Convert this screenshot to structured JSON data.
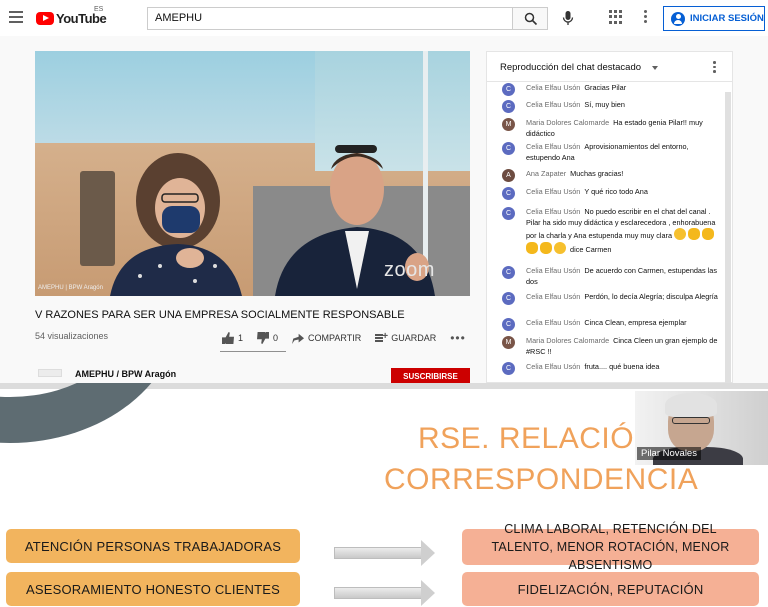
{
  "masthead": {
    "logo_text": "YouTube",
    "country_code": "ES",
    "search_value": "AMEPHU",
    "signin_label": "INICIAR SESIÓN"
  },
  "video": {
    "overlay_brand": "zoom",
    "credit": "AMEPHU | BPW Aragón",
    "title": "V RAZONES PARA SER UNA EMPRESA SOCIALMENTE RESPONSABLE",
    "views": "54 visualizaciones",
    "likes": "1",
    "dislikes": "0",
    "share_label": "COMPARTIR",
    "save_label": "GUARDAR",
    "more_label": "•••",
    "channel_name": "AMEPHU / BPW Aragón",
    "subscribe_label": "SUSCRIBIRSE"
  },
  "chat": {
    "title": "Reproducción del chat destacado",
    "messages": [
      {
        "initial": "C",
        "color": "#5c6bc0",
        "author": "Celia Elfau Usón",
        "text": "Gracias Pilar"
      },
      {
        "initial": "C",
        "color": "#5c6bc0",
        "author": "Celia Elfau Usón",
        "text": "Sí, muy bien"
      },
      {
        "initial": "M",
        "color": "#795548",
        "author": "Maria Dolores Calomarde",
        "text": "Ha estado genia Pilar!! muy didáctico"
      },
      {
        "initial": "C",
        "color": "#5c6bc0",
        "author": "Celia Elfau Usón",
        "text": "Aprovisionamientos del entorno, estupendo Ana"
      },
      {
        "initial": "A",
        "color": "#6d4c41",
        "author": "Ana Zapater",
        "text": "Muchas gracias!"
      },
      {
        "initial": "C",
        "color": "#5c6bc0",
        "author": "Celia Elfau Usón",
        "text": "Y qué rico todo Ana"
      },
      {
        "initial": "C",
        "color": "#5c6bc0",
        "author": "Celia Elfau Usón",
        "text": "No puedo escribir en el chat del canal . Pilar ha sido muy didáctica y esclarecedora , enhorabuena por la charla y Ana estupenda muy muy clara",
        "text_after": "dice Carmen"
      },
      {
        "initial": "C",
        "color": "#5c6bc0",
        "author": "Celia Elfau Usón",
        "text": "De acuerdo con Carmen, estupendas las dos"
      },
      {
        "initial": "C",
        "color": "#5c6bc0",
        "author": "Celia Elfau Usón",
        "text": "Perdón, lo decía Alegría; disculpa Alegría"
      },
      {
        "initial": "C",
        "color": "#5c6bc0",
        "author": "Celia Elfau Usón",
        "text": "Cinca Clean, empresa ejemplar"
      },
      {
        "initial": "M",
        "color": "#795548",
        "author": "Maria Dolores Calomarde",
        "text": "Cinca Cleen un gran ejemplo de #RSC !!"
      },
      {
        "initial": "C",
        "color": "#5c6bc0",
        "author": "Celia Elfau Usón",
        "text": "fruta.... qué buena idea"
      }
    ]
  },
  "slide": {
    "title_line1": "RSE. RELACIÓN",
    "title_line2": "CORRESPONDENCIA",
    "presenter_name": "Pilar Novales",
    "left_boxes": [
      "ATENCIÓN PERSONAS TRABAJADORAS",
      "ASESORAMIENTO HONESTO CLIENTES"
    ],
    "right_boxes": [
      "CLIMA LABORAL, RETENCIÓN DEL TALENTO, MENOR ROTACIÓN, MENOR ABSENTISMO",
      "FIDELIZACIÓN, REPUTACIÓN"
    ],
    "colors": {
      "title": "#f0a25b",
      "left_box": "#f2b45e",
      "right_box": "#f5b095",
      "arc": "#5e6c72"
    }
  }
}
